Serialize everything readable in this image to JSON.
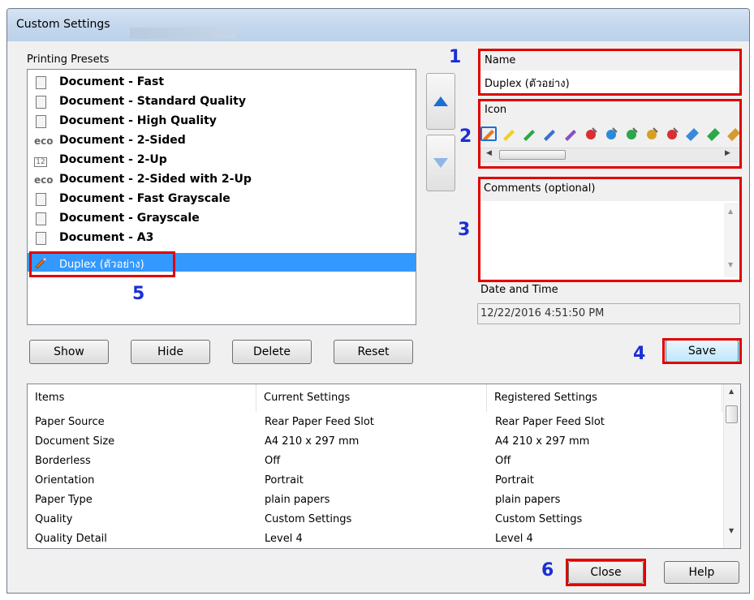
{
  "window": {
    "title": "Custom Settings"
  },
  "presets": {
    "label": "Printing Presets",
    "items": [
      {
        "label": "Document - Fast",
        "icon": "document-icon"
      },
      {
        "label": "Document - Standard Quality",
        "icon": "document-icon"
      },
      {
        "label": "Document - High Quality",
        "icon": "document-icon"
      },
      {
        "label": "Document - 2-Sided",
        "icon": "eco-icon"
      },
      {
        "label": "Document - 2-Up",
        "icon": "two-up-icon"
      },
      {
        "label": "Document - 2-Sided with 2-Up",
        "icon": "eco-icon"
      },
      {
        "label": "Document - Fast Grayscale",
        "icon": "document-icon"
      },
      {
        "label": "Document - Grayscale",
        "icon": "document-icon"
      },
      {
        "label": "Document - A3",
        "icon": "document-icon"
      },
      {
        "label": "Duplex (ตัวอย่าง)",
        "icon": "pencil-icon",
        "selected": true
      }
    ],
    "buttons": {
      "show": "Show",
      "hide": "Hide",
      "delete": "Delete",
      "reset": "Reset"
    }
  },
  "move_buttons": {
    "up_icon": "arrow-up-icon",
    "down_icon": "arrow-down-icon"
  },
  "name": {
    "label": "Name",
    "value": "Duplex (ตัวอย่าง)"
  },
  "icon": {
    "label": "Icon",
    "options": [
      "#e67a22",
      "#f0d020",
      "#2aa84a",
      "#3a6fd0",
      "#8a4fc0",
      "#d83030",
      "#2a8ad8",
      "#2aa84a",
      "#d8a020",
      "#d83030",
      "#3a8ad8",
      "#2aa84a",
      "#d89a30"
    ]
  },
  "comments": {
    "label": "Comments (optional)",
    "value": ""
  },
  "datetime": {
    "label": "Date and Time",
    "value": "12/22/2016 4:51:50 PM"
  },
  "save_label": "Save",
  "table": {
    "headers": [
      "Items",
      "Current Settings",
      "Registered Settings"
    ],
    "rows": [
      [
        "Paper Source",
        "Rear Paper Feed Slot",
        "Rear Paper Feed Slot"
      ],
      [
        "Document Size",
        "A4 210 x 297 mm",
        "A4 210 x 297 mm"
      ],
      [
        "Borderless",
        "Off",
        "Off"
      ],
      [
        "Orientation",
        "Portrait",
        "Portrait"
      ],
      [
        "Paper Type",
        "plain papers",
        "plain papers"
      ],
      [
        "Quality",
        "Custom Settings",
        "Custom Settings"
      ],
      [
        "Quality Detail",
        "Level 4",
        "Level 4"
      ]
    ]
  },
  "footer": {
    "close": "Close",
    "help": "Help"
  },
  "annotations": {
    "n1": "1",
    "n2": "2",
    "n3": "3",
    "n4": "4",
    "n5": "5",
    "n6": "6"
  },
  "colors": {
    "selection": "#3399ff",
    "annotation_box": "#e00000",
    "annotation_number": "#1a2fd6"
  }
}
